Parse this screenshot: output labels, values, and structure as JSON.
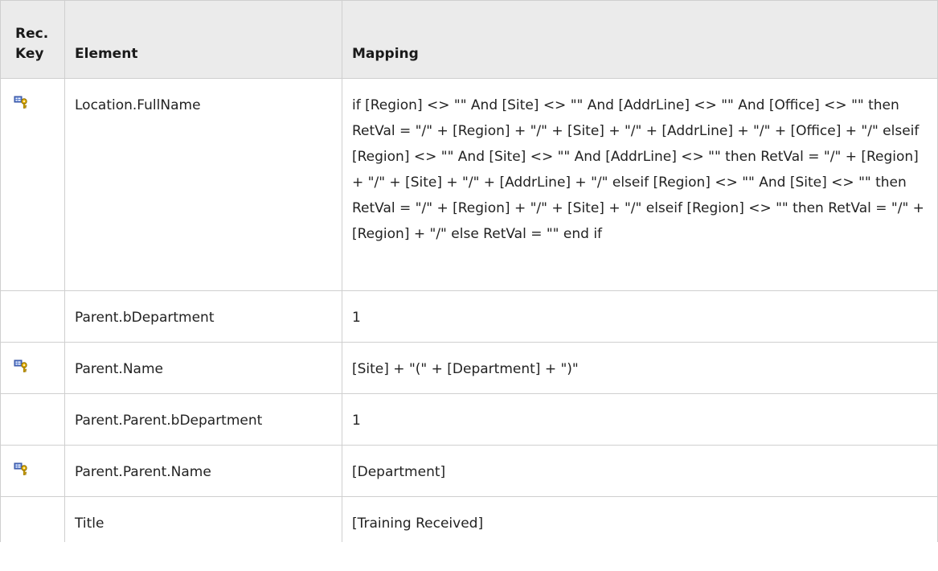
{
  "header": {
    "rec_key": "Rec.\nKey",
    "rec_key_line1": "Rec.",
    "rec_key_line2": "Key",
    "element": "Element",
    "mapping": "Mapping"
  },
  "rows": [
    {
      "rec_key": true,
      "element": "Location.FullName",
      "mapping": "if [Region] <> \"\" And [Site] <> \"\" And [AddrLine] <> \"\" And [Office] <> \"\" then RetVal = \"/\" + [Region] + \"/\" + [Site] + \"/\" + [AddrLine] + \"/\" + [Office] + \"/\" elseif [Region] <> \"\" And [Site] <> \"\" And [AddrLine] <> \"\" then RetVal = \"/\" + [Region] + \"/\" + [Site] + \"/\" + [AddrLine] + \"/\" elseif [Region] <> \"\" And [Site] <> \"\" then RetVal = \"/\" + [Region] + \"/\" + [Site] + \"/\" elseif [Region] <> \"\" then RetVal = \"/\" + [Region] + \"/\" else RetVal = \"\" end if"
    },
    {
      "rec_key": false,
      "element": "Parent.bDepartment",
      "mapping": "1"
    },
    {
      "rec_key": true,
      "element": "Parent.Name",
      "mapping": "[Site] + \"(\" + [Department] + \")\""
    },
    {
      "rec_key": false,
      "element": "Parent.Parent.bDepartment",
      "mapping": "1"
    },
    {
      "rec_key": true,
      "element": "Parent.Parent.Name",
      "mapping": "[Department]"
    },
    {
      "rec_key": false,
      "element": "Title",
      "mapping": "[Training Received]"
    }
  ],
  "icons": {
    "rec_key_icon": "key-icon"
  }
}
